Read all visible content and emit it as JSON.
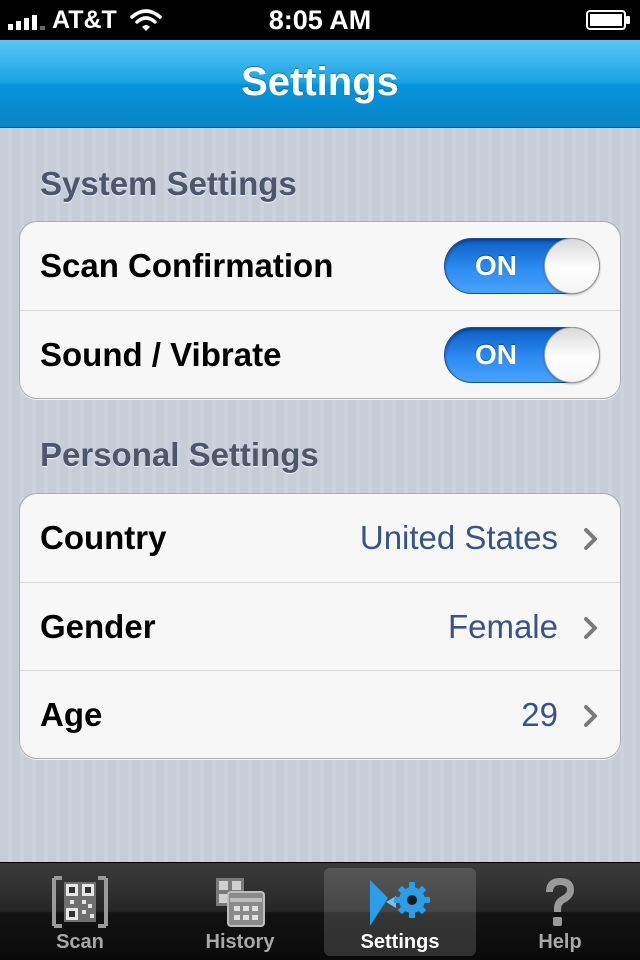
{
  "status_bar": {
    "carrier": "AT&T",
    "time": "8:05 AM",
    "icons": [
      "signal-bars-icon",
      "wifi-icon",
      "battery-icon"
    ]
  },
  "nav_bar": {
    "title": "Settings"
  },
  "system_settings": {
    "header": "System Settings",
    "rows": [
      {
        "label": "Scan Confirmation",
        "toggle": "ON"
      },
      {
        "label": "Sound / Vibrate",
        "toggle": "ON"
      }
    ]
  },
  "personal_settings": {
    "header": "Personal Settings",
    "rows": [
      {
        "label": "Country",
        "value": "United States"
      },
      {
        "label": "Gender",
        "value": "Female"
      },
      {
        "label": "Age",
        "value": "29"
      }
    ]
  },
  "tab_bar": {
    "selected": "Settings",
    "tabs": [
      {
        "label": "Scan",
        "icon": "qr-code-icon"
      },
      {
        "label": "History",
        "icon": "history-icon"
      },
      {
        "label": "Settings",
        "icon": "settings-gears-icon"
      },
      {
        "label": "Help",
        "icon": "question-mark-icon"
      }
    ]
  },
  "colors": {
    "nav_blue": "#1aa4e6",
    "toggle_blue": "#2c8cf3",
    "value_text": "#385487",
    "section_header": "#4c566c",
    "settings_icon_blue": "#2a9fe8"
  }
}
